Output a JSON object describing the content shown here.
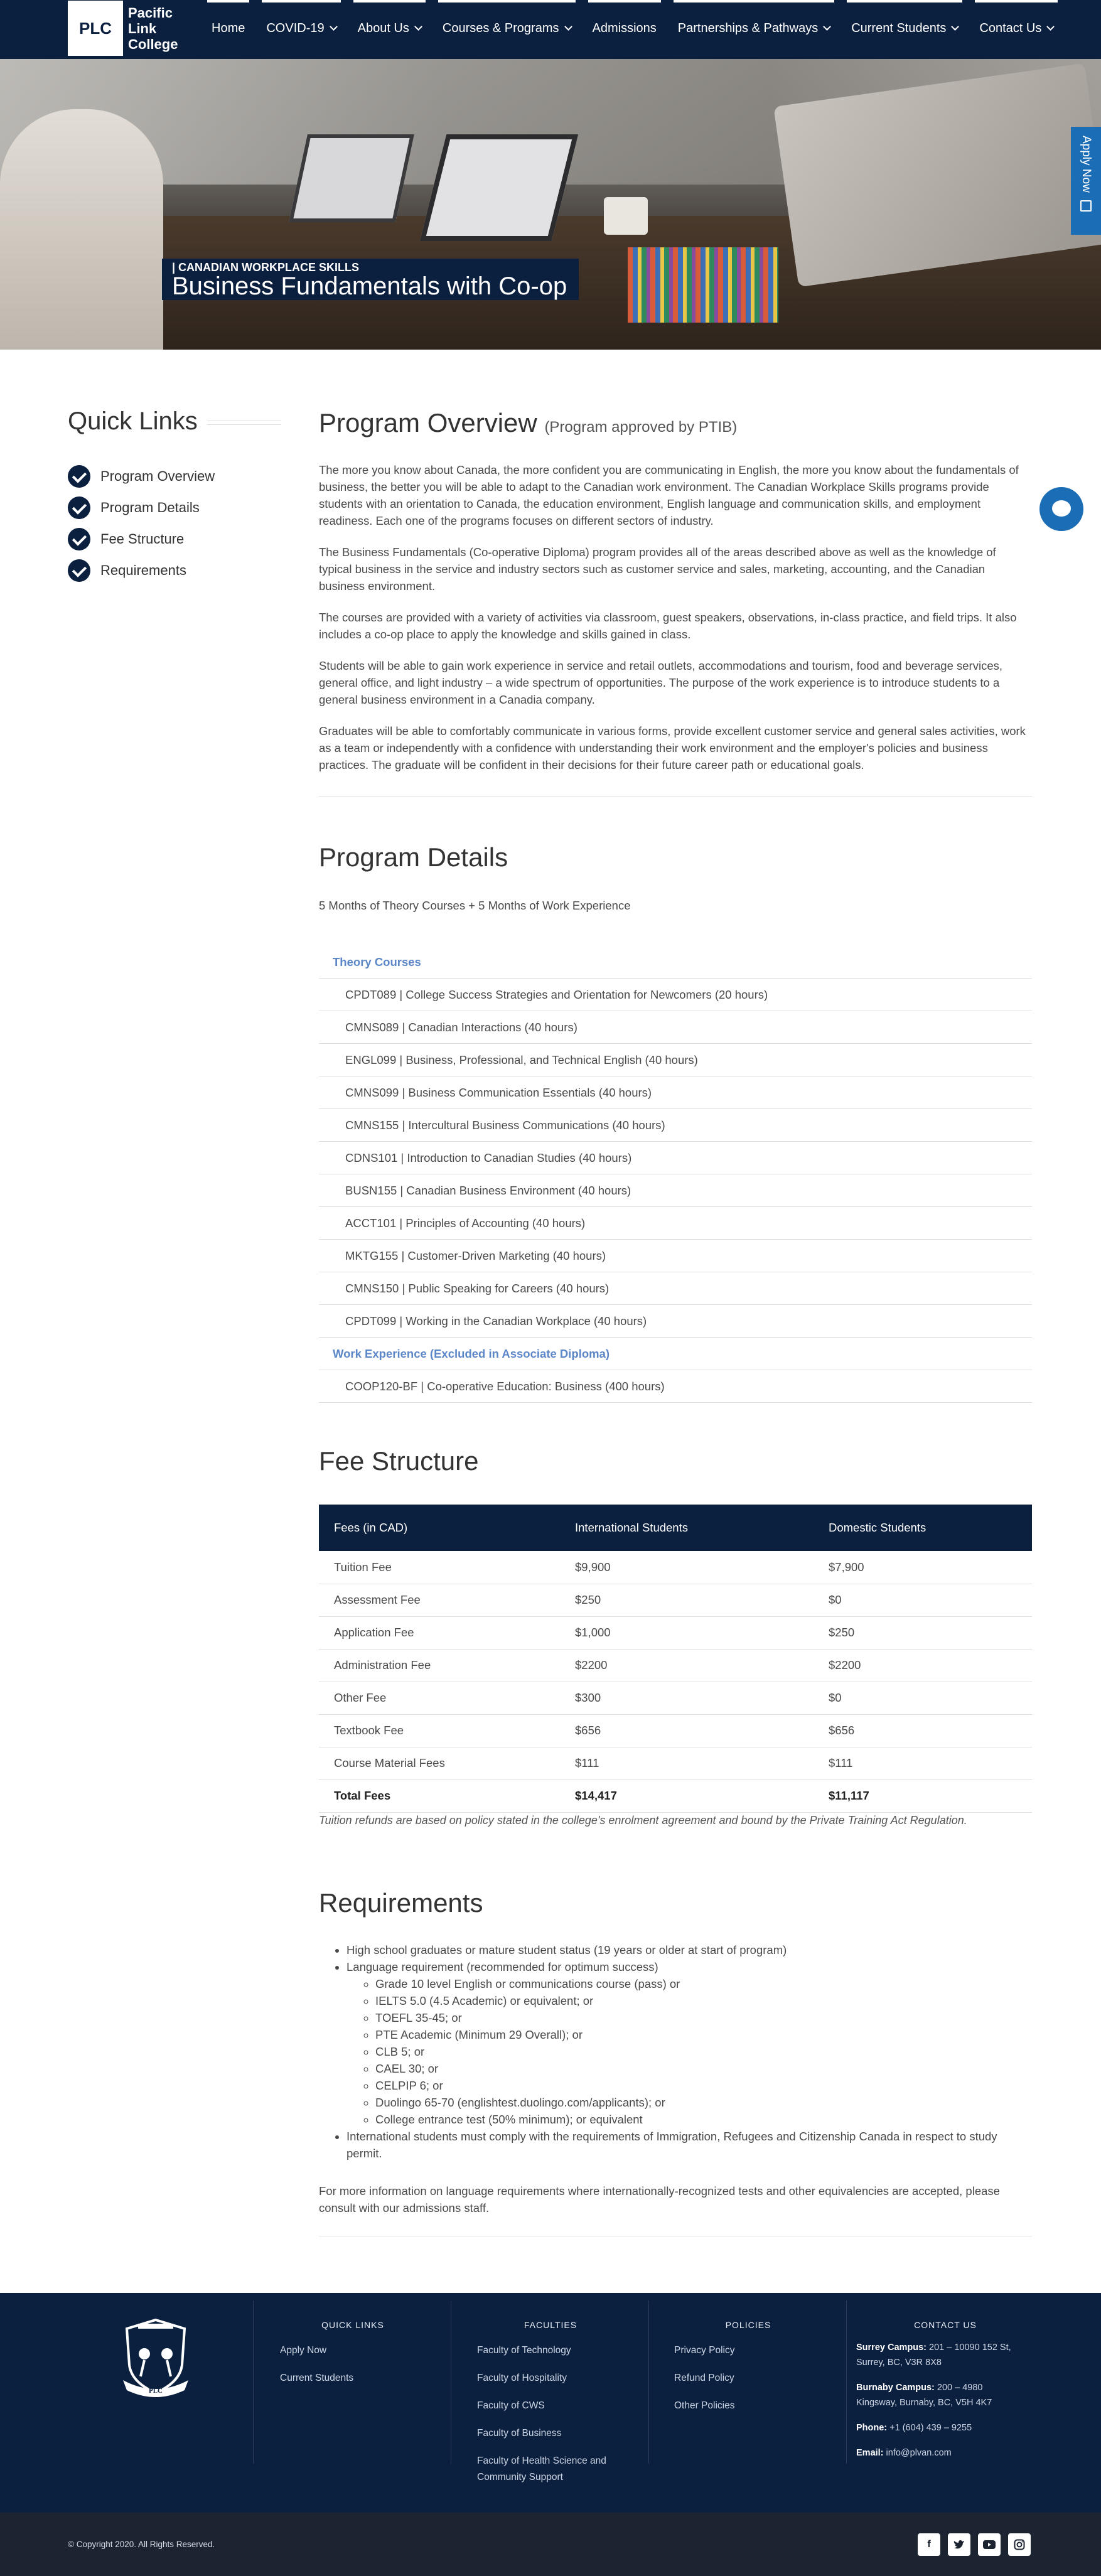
{
  "header": {
    "logo_mark": "PLC",
    "logo_line1": "Pacific",
    "logo_line2": "Link",
    "logo_line3": "College",
    "nav": [
      {
        "label": "Home",
        "dropdown": false
      },
      {
        "label": "COVID-19",
        "dropdown": true
      },
      {
        "label": "About Us",
        "dropdown": true
      },
      {
        "label": "Courses & Programs",
        "dropdown": true
      },
      {
        "label": "Admissions",
        "dropdown": false
      },
      {
        "label": "Partnerships & Pathways",
        "dropdown": true
      },
      {
        "label": "Current Students",
        "dropdown": true
      },
      {
        "label": "Contact Us",
        "dropdown": true
      }
    ]
  },
  "hero": {
    "subtitle": "| CANADIAN WORKPLACE SKILLS",
    "title": "Business Fundamentals with Co-op"
  },
  "floating": {
    "apply_now": "Apply Now"
  },
  "quick_links": {
    "title": "Quick Links",
    "items": [
      "Program Overview",
      "Program Details",
      "Fee Structure",
      "Requirements"
    ]
  },
  "overview": {
    "title": "Program Overview",
    "title_note": "(Program approved by PTIB)",
    "paragraphs": [
      "The more you know about Canada, the more confident you are communicating in English, the more you know about the fundamentals of business, the better you will be able to adapt to the Canadian work environment. The Canadian Workplace Skills programs provide students with an orientation to Canada, the education environment, English language and communication skills, and employment readiness. Each one of the programs focuses on different sectors of industry.",
      "The Business Fundamentals (Co-operative Diploma) program provides all of the areas described above as well as the knowledge of typical business in the service and industry sectors such as customer service and sales, marketing, accounting, and the Canadian business environment.",
      "The courses are provided with a variety of activities via classroom, guest speakers, observations, in-class practice, and field trips. It also includes a co-op place to apply the knowledge and skills gained in class.",
      "Students will be able to gain work experience in service and retail outlets, accommodations and tourism, food and beverage services, general office, and light industry – a wide spectrum of opportunities. The purpose of the work experience is to introduce students to a general business environment in a Canadia company.",
      "Graduates will be able to comfortably communicate in various forms, provide excellent customer service and general sales activities, work as a team or independently with a confidence with understanding their work environment and the employer's policies and business practices. The graduate will be confident in their decisions for their future career path or educational goals."
    ]
  },
  "details": {
    "title": "Program Details",
    "duration": "5 Months of Theory Courses + 5 Months of Work Experience",
    "theory_heading": "Theory Courses",
    "theory_courses": [
      "CPDT089 | College Success Strategies and Orientation for Newcomers (20 hours)",
      "CMNS089 | Canadian Interactions (40 hours)",
      "ENGL099 | Business, Professional, and Technical English (40 hours)",
      "CMNS099 | Business Communication Essentials (40 hours)",
      "CMNS155 | Intercultural Business Communications (40 hours)",
      "CDNS101 | Introduction to Canadian Studies (40 hours)",
      "BUSN155 | Canadian Business Environment (40 hours)",
      "ACCT101 | Principles of Accounting (40 hours)",
      "MKTG155 | Customer-Driven Marketing (40 hours)",
      "CMNS150 | Public Speaking for Careers (40 hours)",
      "CPDT099 | Working in the Canadian Workplace (40 hours)"
    ],
    "work_heading": "Work Experience (Excluded in Associate Diploma)",
    "work_courses": [
      "COOP120-BF | Co-operative Education: Business (400 hours)"
    ]
  },
  "fees": {
    "title": "Fee Structure",
    "headers": [
      "Fees (in CAD)",
      "International Students",
      "Domestic Students"
    ],
    "rows": [
      [
        "Tuition Fee",
        "$9,900",
        "$7,900"
      ],
      [
        "Assessment Fee",
        "$250",
        "$0"
      ],
      [
        "Application Fee",
        "$1,000",
        "$250"
      ],
      [
        "Administration Fee",
        "$2200",
        "$2200"
      ],
      [
        "Other Fee",
        "$300",
        "$0"
      ],
      [
        "Textbook Fee",
        "$656",
        "$656"
      ],
      [
        "Course Material Fees",
        "$111",
        "$111"
      ]
    ],
    "total": [
      "Total Fees",
      "$14,417",
      "$11,117"
    ],
    "note": "Tuition refunds are based on policy stated in the college's enrolment agreement and bound by the Private Training Act Regulation."
  },
  "requirements": {
    "title": "Requirements",
    "item1": "High school graduates or mature student status (19 years or older at start of program)",
    "item2": "Language requirement (recommended for optimum success)",
    "language_options": [
      "Grade 10 level English or communications course (pass) or",
      "IELTS 5.0 (4.5 Academic) or equivalent; or",
      "TOEFL 35-45; or",
      "PTE Academic (Minimum 29 Overall); or",
      "CLB 5; or",
      "CAEL 30; or",
      "CELPIP 6; or",
      "Duolingo 65-70 (englishtest.duolingo.com/applicants); or",
      "College entrance test (50% minimum); or equivalent"
    ],
    "item3": "International students must comply with the requirements of Immigration, Refugees and Citizenship Canada in respect to study permit.",
    "note": "For more information on language requirements where internationally-recognized tests and other equivalencies are accepted, please consult with our admissions staff."
  },
  "footer": {
    "crest_text": "PLC",
    "quick_links_title": "QUICK LINKS",
    "quick_links": [
      "Apply Now",
      "Current Students"
    ],
    "faculties_title": "FACULTIES",
    "faculties": [
      "Faculty of Technology",
      "Faculty of Hospitality",
      "Faculty of CWS",
      "Faculty of Business",
      "Faculty of Health Science and",
      "Community Support"
    ],
    "policies_title": "POLICIES",
    "policies": [
      "Privacy Policy",
      "Refund Policy",
      "Other Policies"
    ],
    "contact_title": "CONTACT US",
    "surrey_label": "Surrey Campus:",
    "surrey_line1": "201 – 10090 152 St,",
    "surrey_line2": "Surrey, BC, V3R 8X8",
    "burnaby_label": "Burnaby Campus:",
    "burnaby_line1": "200 – 4980",
    "burnaby_line2": "Kingsway, Burnaby, BC, V5H 4K7",
    "phone_label": "Phone:",
    "phone": "+1 (604) 439 – 9255",
    "email_label": "Email:",
    "email": "info@plvan.com",
    "copyright": "© Copyright 2020. All Rights Reserved.",
    "social": [
      "facebook-icon",
      "twitter-icon",
      "youtube-icon",
      "instagram-icon"
    ]
  }
}
